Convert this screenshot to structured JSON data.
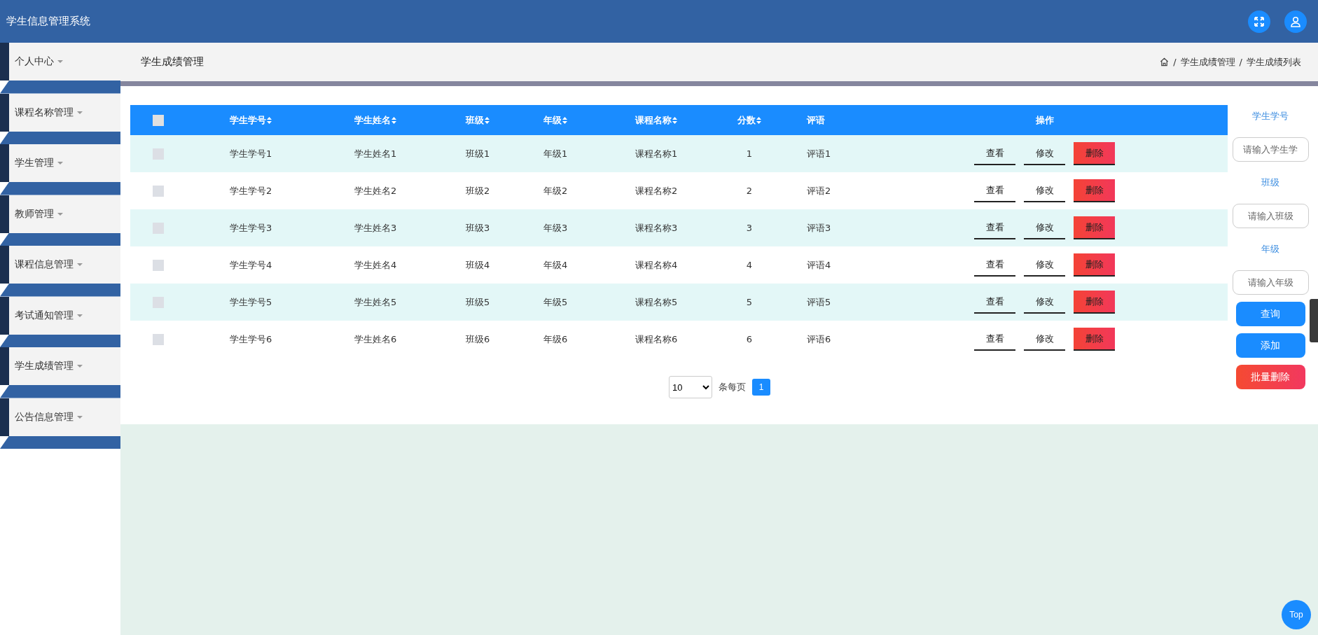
{
  "header": {
    "title": "学生信息管理系统"
  },
  "sidebar": {
    "items": [
      {
        "label": "个人中心"
      },
      {
        "label": "课程名称管理"
      },
      {
        "label": "学生管理"
      },
      {
        "label": "教师管理"
      },
      {
        "label": "课程信息管理"
      },
      {
        "label": "考试通知管理"
      },
      {
        "label": "学生成绩管理"
      },
      {
        "label": "公告信息管理"
      }
    ]
  },
  "page_title": "学生成绩管理",
  "breadcrumb": [
    "学生成绩管理",
    "学生成绩列表"
  ],
  "breadcrumb_separators": [
    "/",
    "/"
  ],
  "table": {
    "select_all": {
      "checked": false
    },
    "columns": [
      {
        "label": "学生学号",
        "sortable": true
      },
      {
        "label": "学生姓名",
        "sortable": true
      },
      {
        "label": "班级",
        "sortable": true
      },
      {
        "label": "年级",
        "sortable": true
      },
      {
        "label": "课程名称",
        "sortable": true
      },
      {
        "label": "分数",
        "sortable": true
      },
      {
        "label": "评语",
        "sortable": false
      },
      {
        "label": "操作",
        "sortable": false
      }
    ],
    "rows": [
      {
        "checked": false,
        "cells": [
          "学生学号1",
          "学生姓名1",
          "班级1",
          "年级1",
          "课程名称1",
          "1",
          "评语1"
        ],
        "actions": [
          {
            "label": "查看",
            "kind": "plain"
          },
          {
            "label": "修改",
            "kind": "plain"
          },
          {
            "label": "删除",
            "kind": "danger"
          }
        ]
      },
      {
        "checked": false,
        "cells": [
          "学生学号2",
          "学生姓名2",
          "班级2",
          "年级2",
          "课程名称2",
          "2",
          "评语2"
        ],
        "actions": [
          {
            "label": "查看",
            "kind": "plain"
          },
          {
            "label": "修改",
            "kind": "plain"
          },
          {
            "label": "删除",
            "kind": "danger"
          }
        ]
      },
      {
        "checked": false,
        "cells": [
          "学生学号3",
          "学生姓名3",
          "班级3",
          "年级3",
          "课程名称3",
          "3",
          "评语3"
        ],
        "actions": [
          {
            "label": "查看",
            "kind": "plain"
          },
          {
            "label": "修改",
            "kind": "plain"
          },
          {
            "label": "删除",
            "kind": "danger"
          }
        ]
      },
      {
        "checked": false,
        "cells": [
          "学生学号4",
          "学生姓名4",
          "班级4",
          "年级4",
          "课程名称4",
          "4",
          "评语4"
        ],
        "actions": [
          {
            "label": "查看",
            "kind": "plain"
          },
          {
            "label": "修改",
            "kind": "plain"
          },
          {
            "label": "删除",
            "kind": "danger"
          }
        ]
      },
      {
        "checked": false,
        "cells": [
          "学生学号5",
          "学生姓名5",
          "班级5",
          "年级5",
          "课程名称5",
          "5",
          "评语5"
        ],
        "actions": [
          {
            "label": "查看",
            "kind": "plain"
          },
          {
            "label": "修改",
            "kind": "plain"
          },
          {
            "label": "删除",
            "kind": "danger"
          }
        ]
      },
      {
        "checked": false,
        "cells": [
          "学生学号6",
          "学生姓名6",
          "班级6",
          "年级6",
          "课程名称6",
          "6",
          "评语6"
        ],
        "actions": [
          {
            "label": "查看",
            "kind": "plain"
          },
          {
            "label": "修改",
            "kind": "plain"
          },
          {
            "label": "删除",
            "kind": "danger"
          }
        ]
      }
    ]
  },
  "pagination": {
    "page_size": "10",
    "page_size_label": "条每页",
    "pages": [
      {
        "label": "1",
        "selected": true
      }
    ]
  },
  "search_panel": {
    "fields": [
      {
        "label": "学生学号",
        "placeholder": "请输入学生学"
      },
      {
        "label": "班级",
        "placeholder": "请输入班级"
      },
      {
        "label": "年级",
        "placeholder": "请输入年级"
      }
    ],
    "buttons": [
      {
        "label": "查询",
        "kind": "primary"
      },
      {
        "label": "添加",
        "kind": "primary"
      },
      {
        "label": "批量删除",
        "kind": "danger"
      }
    ]
  },
  "back_to_top": "Top"
}
